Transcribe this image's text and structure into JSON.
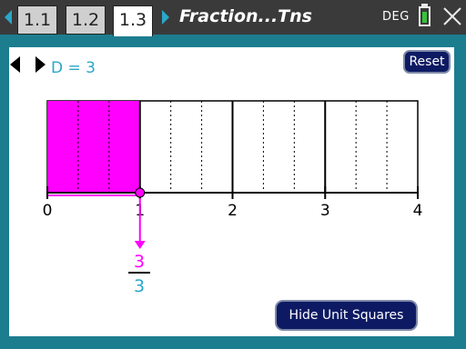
{
  "tabs": [
    {
      "label": "1.1"
    },
    {
      "label": "1.2"
    },
    {
      "label": "1.3"
    }
  ],
  "document_title": "Fraction...Tns",
  "angle_mode": "DEG",
  "battery_level": 0.85,
  "colors": {
    "top_bar": "#3a3a3a",
    "frame": "#1c7d8f",
    "accent_blue": "#2aa7c9",
    "shaded": "#ff00ff",
    "button_bg": "#0d1a63"
  },
  "icons": [
    "nav-left-icon",
    "nav-right-icon",
    "battery-icon",
    "close-icon",
    "left-arrow-icon",
    "right-arrow-icon"
  ],
  "denominator_control": {
    "label": "D = 3",
    "value": 3
  },
  "reset_label": "Reset",
  "number_line": {
    "min": 0,
    "max": 4,
    "tick_labels": [
      "0",
      "1",
      "2",
      "3",
      "4"
    ],
    "denominator": 3,
    "point_value": 1
  },
  "fraction": {
    "numerator": "3",
    "denominator": "3"
  },
  "hide_button_label": "Hide Unit Squares"
}
